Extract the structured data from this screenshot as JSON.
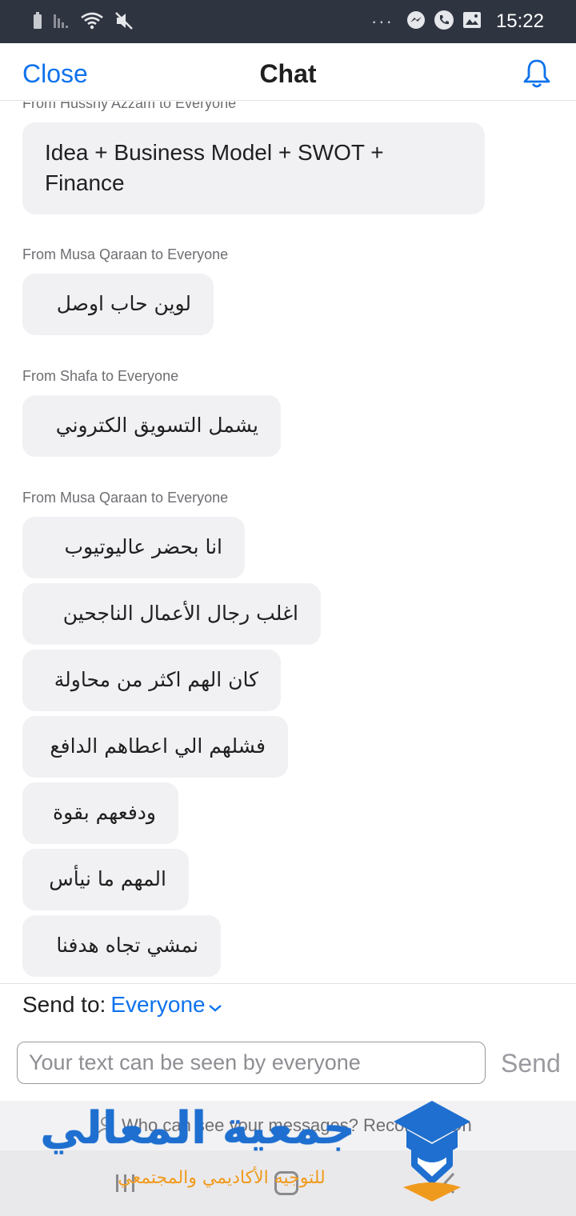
{
  "status_bar": {
    "time": "15:22",
    "more": "···",
    "icons_left": [
      "battery-saver-icon",
      "signal-icon",
      "wifi-icon",
      "mute-icon"
    ],
    "icons_right": [
      "messenger-icon",
      "phone-icon",
      "gallery-icon"
    ]
  },
  "header": {
    "close_label": "Close",
    "title": "Chat",
    "bell_icon": "bell-icon"
  },
  "messages": [
    {
      "from": "From Hussny Azzam to Everyone",
      "bubbles": [
        "Idea + Business Model + SWOT + Finance"
      ]
    },
    {
      "from": "From Musa Qaraan to Everyone",
      "bubbles": [
        "لوين حاب اوصل"
      ]
    },
    {
      "from": "From Shafa to Everyone",
      "bubbles": [
        "يشمل التسويق الكتروني"
      ]
    },
    {
      "from": "From Musa Qaraan to Everyone",
      "bubbles": [
        "انا بحضر عاليوتيوب",
        "اغلب رجال الأعمال الناجحين",
        "كان الهم اكثر من محاولة",
        "فشلهم الي اعطاهم الدافع",
        "ودفعهم بقوة",
        "المهم ما نيأس",
        "نمشي تجاه هدفنا"
      ]
    }
  ],
  "composer": {
    "send_to_label": "Send to:",
    "send_to_value": "Everyone",
    "input_value": "",
    "input_placeholder": "Your text can be seen by everyone",
    "send_label": "Send"
  },
  "banner": {
    "text": "Who can see your messages? Recording On",
    "icon": "person-icon"
  },
  "watermark": {
    "title": "جمعية المعالي",
    "subtitle": "للتوجيه الأكاديمي والمجتمعي"
  },
  "nav_bar": {
    "icons": [
      "recents-icon",
      "home-icon",
      "back-icon"
    ]
  },
  "colors": {
    "accent": "#0e72ed",
    "status_bar": "#2f3441",
    "bubble": "#f1f1f4",
    "watermark_blue": "#1e6fd0",
    "watermark_orange": "#f09a1d"
  }
}
